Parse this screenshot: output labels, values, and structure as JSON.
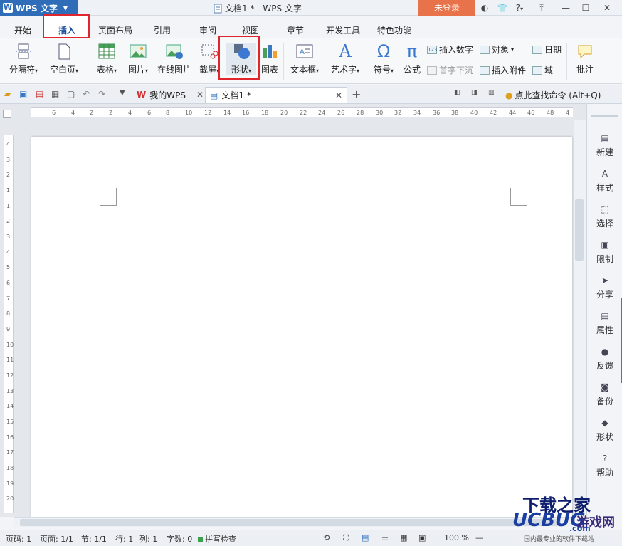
{
  "titlebar": {
    "app_name": "WPS 文字",
    "doc_title": "文档1 * - WPS 文字",
    "login_label": "未登录",
    "help_label": "?"
  },
  "menubar": {
    "tabs": [
      {
        "label": "开始"
      },
      {
        "label": "插入"
      },
      {
        "label": "页面布局"
      },
      {
        "label": "引用"
      },
      {
        "label": "审阅"
      },
      {
        "label": "视图"
      },
      {
        "label": "章节"
      },
      {
        "label": "开发工具"
      },
      {
        "label": "特色功能"
      }
    ]
  },
  "ribbon": {
    "page_break": "分隔符",
    "blank_page": "空白页",
    "table": "表格",
    "picture": "图片",
    "online_picture": "在线图片",
    "screenshot": "截屏",
    "shape": "形状",
    "chart": "图表",
    "textbox": "文本框",
    "wordart": "艺术字",
    "symbol": "符号",
    "formula": "公式",
    "insert_number": "插入数字",
    "object": "对象",
    "date": "日期",
    "drop_cap": "首字下沉",
    "attachment": "插入附件",
    "field": "域",
    "comment": "批注",
    "number_badge": "123"
  },
  "docbar": {
    "wps_home_tab": "我的WPS",
    "doc_tab": "文档1 *",
    "find_command": "点此查找命令 (Alt+Q)"
  },
  "sidebar": {
    "items": [
      {
        "label": "新建"
      },
      {
        "label": "样式"
      },
      {
        "label": "选择"
      },
      {
        "label": "限制"
      },
      {
        "label": "分享"
      },
      {
        "label": "属性"
      },
      {
        "label": "反馈"
      },
      {
        "label": "备份"
      },
      {
        "label": "形状"
      },
      {
        "label": "帮助"
      }
    ]
  },
  "statusbar": {
    "page_num": "页码: 1",
    "page_count": "页面: 1/1",
    "section": "节: 1/1",
    "row": "行: 1",
    "col": "列: 1",
    "word_count": "字数: 0",
    "spell_check": "拼写检查",
    "zoom": "100 %"
  },
  "watermark": {
    "brand": "UCBUG",
    "site_text": "下载之家",
    "game_text": "游戏网",
    "domain": ".com",
    "tagline": "国内最专业的软件下载站"
  },
  "ruler": {
    "h_ticks": [
      "6",
      "4",
      "2",
      "2",
      "4",
      "6",
      "8",
      "10",
      "12",
      "14",
      "16",
      "18",
      "20",
      "22",
      "24",
      "26",
      "28",
      "30",
      "32",
      "34",
      "36",
      "38",
      "40",
      "42",
      "44",
      "46",
      "48",
      "4"
    ],
    "v_ticks": [
      "4",
      "3",
      "2",
      "1",
      "1",
      "2",
      "3",
      "4",
      "5",
      "6",
      "7",
      "8",
      "9",
      "10",
      "11",
      "12",
      "13",
      "14",
      "15",
      "16",
      "17",
      "18",
      "19",
      "20"
    ]
  },
  "colors": {
    "accent": "#2f6db8",
    "highlight_box": "#e0262c",
    "login_bg": "#e8734a"
  }
}
